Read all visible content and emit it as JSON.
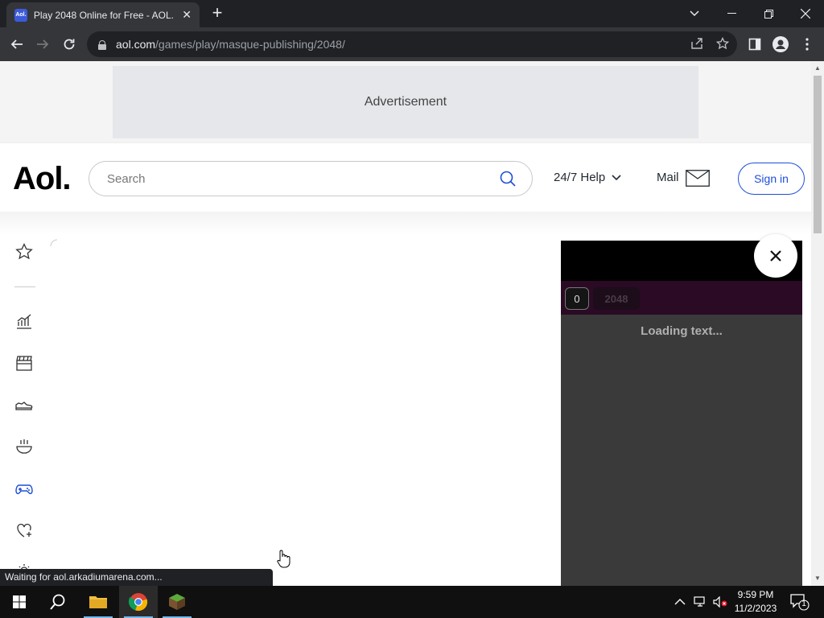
{
  "browser": {
    "tab_title": "Play 2048 Online for Free - AOL.",
    "tab_favicon_text": "Aol.",
    "url_host": "aol.com",
    "url_path": "/games/play/masque-publishing/2048/",
    "status_text": "Waiting for aol.arkadiumarena.com..."
  },
  "ad": {
    "label": "Advertisement"
  },
  "header": {
    "logo": "Aol.",
    "search_placeholder": "Search",
    "help_label": "24/7 Help",
    "mail_label": "Mail",
    "signin_label": "Sign in"
  },
  "sidebar": {
    "items": [
      {
        "icon": "star-icon"
      },
      {
        "icon": "chart-icon"
      },
      {
        "icon": "clapperboard-icon"
      },
      {
        "icon": "shoe-icon"
      },
      {
        "icon": "bowl-icon"
      },
      {
        "icon": "gamepad-icon",
        "active": true
      },
      {
        "icon": "heart-plus-icon"
      }
    ]
  },
  "game": {
    "score": "0",
    "best_label": "2048",
    "loading_text": "Loading text..."
  },
  "taskbar": {
    "time": "9:59 PM",
    "date": "11/2/2023",
    "notification_count": "1"
  },
  "colors": {
    "accent": "#1d4ed8",
    "chrome_dark": "#202124",
    "game_bg": "#3a3a3a"
  }
}
